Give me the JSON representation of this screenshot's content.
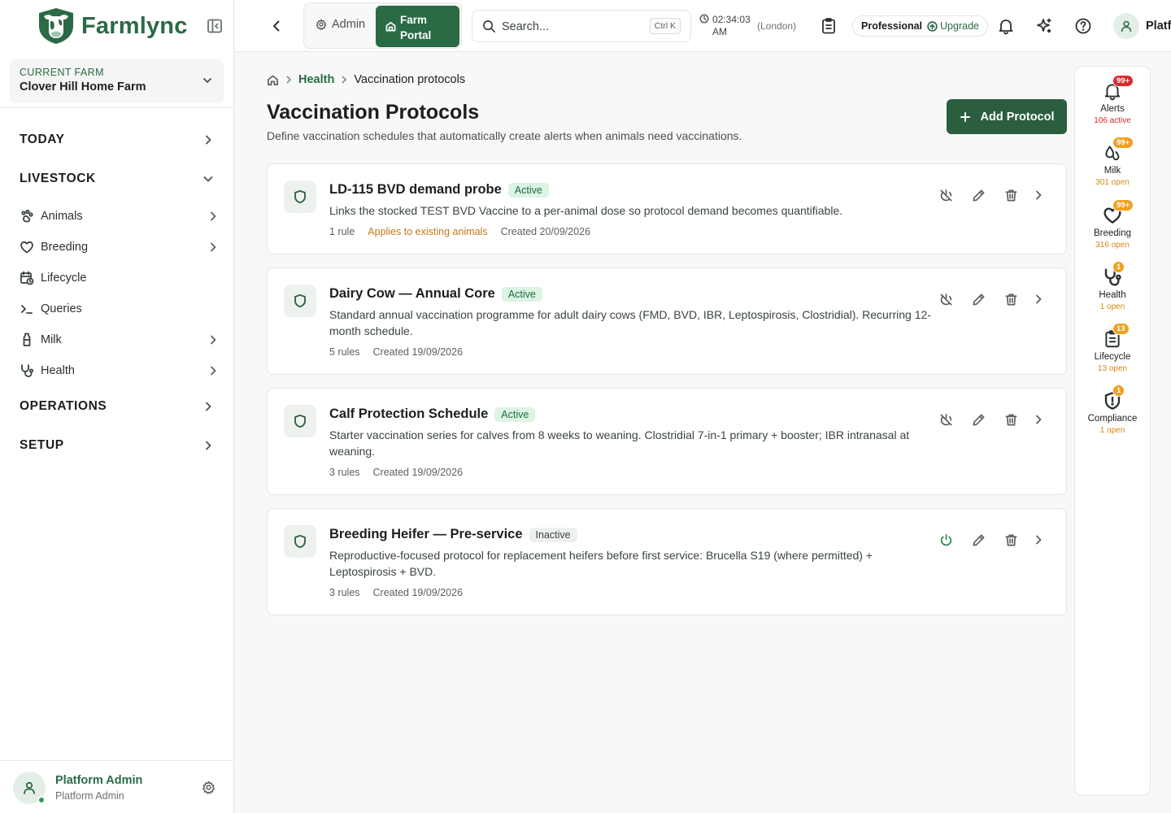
{
  "app": {
    "brand": "Farmlync"
  },
  "farm": {
    "label": "CURRENT FARM",
    "name": "Clover Hill Home Farm"
  },
  "nav": {
    "today": "TODAY",
    "livestock": "LIVESTOCK",
    "items": [
      {
        "label": "Animals",
        "icon": "paw-icon"
      },
      {
        "label": "Breeding",
        "icon": "heart-icon"
      },
      {
        "label": "Lifecycle",
        "icon": "calendar-clock-icon"
      },
      {
        "label": "Queries",
        "icon": "terminal-icon"
      },
      {
        "label": "Milk",
        "icon": "milk-bottle-icon"
      },
      {
        "label": "Health",
        "icon": "stethoscope-icon"
      }
    ],
    "operations": "OPERATIONS",
    "setup": "SETUP"
  },
  "user": {
    "name": "Platform Admin",
    "role": "Platform Admin",
    "topbar_name": "Platf"
  },
  "topbar": {
    "admin_label": "Admin",
    "farm_portal_label": "Farm Portal",
    "search_placeholder": "Search...",
    "search_shortcut": "Ctrl K",
    "time": "02:34:03 AM",
    "timezone": "(London)",
    "plan": "Professional",
    "upgrade": "Upgrade"
  },
  "breadcrumb": {
    "parent": "Health",
    "current": "Vaccination protocols"
  },
  "page": {
    "title": "Vaccination Protocols",
    "subtitle": "Define vaccination schedules that automatically create alerts when animals need vaccinations.",
    "add_button": "Add Protocol"
  },
  "protocols": [
    {
      "name": "LD-115 BVD demand probe",
      "status": "Active",
      "description": "Links the stocked TEST BVD Vaccine to a per-animal dose so protocol demand becomes quantifiable.",
      "rules": "1 rule",
      "flag": "Applies to existing animals",
      "created": "Created 20/09/2026"
    },
    {
      "name": "Dairy Cow — Annual Core",
      "status": "Active",
      "description": "Standard annual vaccination programme for adult dairy cows (FMD, BVD, IBR, Leptospirosis, Clostridial). Recurring 12-month schedule.",
      "rules": "5 rules",
      "created": "Created 19/09/2026"
    },
    {
      "name": "Calf Protection Schedule",
      "status": "Active",
      "description": "Starter vaccination series for calves from 8 weeks to weaning. Clostridial 7-in-1 primary + booster; IBR intranasal at weaning.",
      "rules": "3 rules",
      "created": "Created 19/09/2026"
    },
    {
      "name": "Breeding Heifer — Pre-service",
      "status": "Inactive",
      "description": "Reproductive-focused protocol for replacement heifers before first service: Brucella S19 (where permitted) + Leptospirosis + BVD.",
      "rules": "3 rules",
      "created": "Created 19/09/2026"
    }
  ],
  "rail": [
    {
      "label": "Alerts",
      "badge": "99+",
      "count": "106 active",
      "tone": "red",
      "icon": "bell-icon"
    },
    {
      "label": "Milk",
      "badge": "99+",
      "count": "301 open",
      "tone": "amber",
      "icon": "milk-drops-icon"
    },
    {
      "label": "Breeding",
      "badge": "99+",
      "count": "316 open",
      "tone": "amber",
      "icon": "heart-icon"
    },
    {
      "label": "Health",
      "badge": "1",
      "count": "1 open",
      "tone": "amber",
      "icon": "stethoscope-icon"
    },
    {
      "label": "Lifecycle",
      "badge": "13",
      "count": "13 open",
      "tone": "amber",
      "icon": "clipboard-icon"
    },
    {
      "label": "Compliance",
      "badge": "1",
      "count": "1 open",
      "tone": "amber",
      "icon": "shield-alert-icon"
    }
  ],
  "colors": {
    "brand": "#2a6a45",
    "button": "#2a5e3f",
    "alert": "#d62b2b",
    "warning": "#f0a020"
  }
}
